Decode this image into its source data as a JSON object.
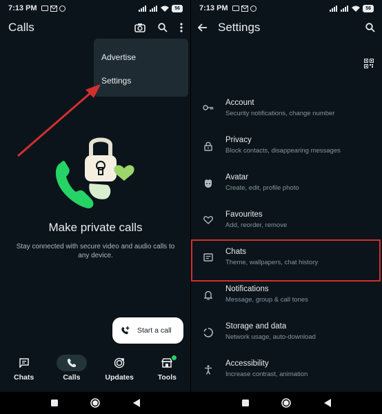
{
  "left": {
    "status_time": "7:13 PM",
    "battery": "56",
    "title": "Calls",
    "menu": [
      "Advertise",
      "Settings"
    ],
    "empty_title": "Make private calls",
    "empty_subtitle": "Stay connected with secure video and audio calls to any device.",
    "fab_label": "Start a call",
    "tabs": [
      {
        "label": "Chats",
        "icon": "chat-icon"
      },
      {
        "label": "Calls",
        "icon": "phone-icon"
      },
      {
        "label": "Updates",
        "icon": "updates-icon"
      },
      {
        "label": "Tools",
        "icon": "tools-icon"
      }
    ],
    "active_tab": "Calls"
  },
  "right": {
    "status_time": "7:13 PM",
    "battery": "56",
    "title": "Settings",
    "items": [
      {
        "title": "Account",
        "subtitle": "Security notifications, change number",
        "icon": "key-icon"
      },
      {
        "title": "Privacy",
        "subtitle": "Block contacts, disappearing messages",
        "icon": "lock-icon"
      },
      {
        "title": "Avatar",
        "subtitle": "Create, edit, profile photo",
        "icon": "avatar-icon"
      },
      {
        "title": "Favourites",
        "subtitle": "Add, reorder, remove",
        "icon": "heart-icon"
      },
      {
        "title": "Chats",
        "subtitle": "Theme, wallpapers, chat history",
        "icon": "chat-icon"
      },
      {
        "title": "Notifications",
        "subtitle": "Message, group & call tones",
        "icon": "bell-icon"
      },
      {
        "title": "Storage and data",
        "subtitle": "Network usage, auto-download",
        "icon": "storage-icon"
      },
      {
        "title": "Accessibility",
        "subtitle": "Increase contrast, animation",
        "icon": "accessibility-icon"
      }
    ],
    "highlighted_item": "Chats"
  },
  "colors": {
    "background": "#0b141a",
    "accent_green": "#25d366",
    "highlight_red": "#d32f2f",
    "menu_bg": "#1f2b33"
  }
}
